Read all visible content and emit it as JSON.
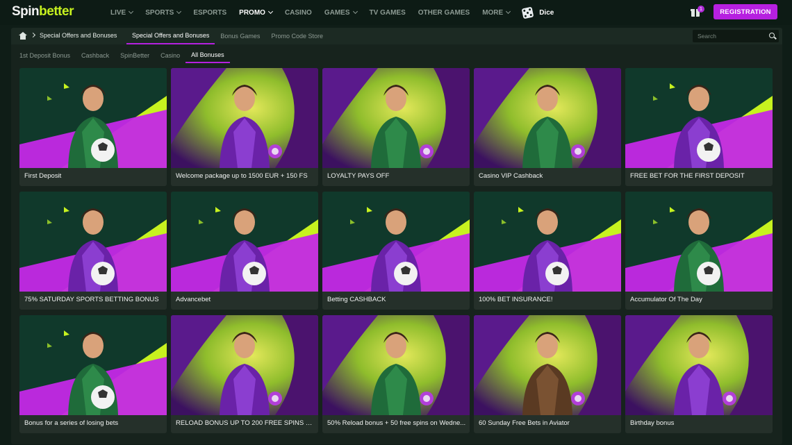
{
  "logo": {
    "part1": "Spin",
    "part2": "better"
  },
  "nav": [
    {
      "label": "LIVE",
      "caret": true,
      "active": false
    },
    {
      "label": "SPORTS",
      "caret": true,
      "active": false
    },
    {
      "label": "ESPORTS",
      "caret": false,
      "active": false
    },
    {
      "label": "PROMO",
      "caret": true,
      "active": true
    },
    {
      "label": "CASINO",
      "caret": false,
      "active": false
    },
    {
      "label": "GAMES",
      "caret": true,
      "active": false
    },
    {
      "label": "TV GAMES",
      "caret": false,
      "active": false
    },
    {
      "label": "OTHER GAMES",
      "caret": false,
      "active": false
    },
    {
      "label": "MORE",
      "caret": true,
      "active": false
    }
  ],
  "nav_dice": "Dice",
  "gift_count": "1",
  "registration_label": "REGISTRATION",
  "breadcrumb": {
    "current": "Special Offers and Bonuses"
  },
  "tabs": [
    {
      "label": "Special Offers and Bonuses",
      "active": true
    },
    {
      "label": "Bonus Games",
      "active": false
    },
    {
      "label": "Promo Code Store",
      "active": false
    }
  ],
  "search_placeholder": "Search",
  "filters": [
    {
      "label": "1st Deposit Bonus",
      "active": false
    },
    {
      "label": "Cashback",
      "active": false
    },
    {
      "label": "SpinBetter",
      "active": false
    },
    {
      "label": "Casino",
      "active": false
    },
    {
      "label": "All Bonuses",
      "active": true
    }
  ],
  "colors": {
    "accent": "#b620e0",
    "lime": "#c7f21f",
    "purple": "#9a28c9",
    "dark_green": "#123528"
  },
  "bonuses": [
    {
      "title": "First Deposit",
      "theme": "sport",
      "figure": "green"
    },
    {
      "title": "Welcome package up to 1500 EUR + 150 FS",
      "theme": "casino",
      "figure": "purple"
    },
    {
      "title": "LOYALTY PAYS OFF",
      "theme": "casino",
      "figure": "green"
    },
    {
      "title": "Casino VIP Cashback",
      "theme": "casino",
      "figure": "green"
    },
    {
      "title": "FREE BET FOR THE FIRST DEPOSIT",
      "theme": "sport",
      "figure": "purple"
    },
    {
      "title": "75% SATURDAY SPORTS BETTING BONUS",
      "theme": "sport",
      "figure": "purple"
    },
    {
      "title": "Advancebet",
      "theme": "sport",
      "figure": "purple"
    },
    {
      "title": "Betting CASHBACK",
      "theme": "sport",
      "figure": "purple"
    },
    {
      "title": "100% BET INSURANCE!",
      "theme": "sport",
      "figure": "purple"
    },
    {
      "title": "Accumulator Of The Day",
      "theme": "sport",
      "figure": "green"
    },
    {
      "title": "Bonus for a series of losing bets",
      "theme": "sport",
      "figure": "green"
    },
    {
      "title": "RELOAD BONUS UP TO 200 FREE SPINS ON ...",
      "theme": "casino",
      "figure": "purple"
    },
    {
      "title": "50% Reload bonus + 50 free spins on Wedne...",
      "theme": "casino",
      "figure": "green"
    },
    {
      "title": "60 Sunday Free Bets in Aviator",
      "theme": "casino",
      "figure": "brown"
    },
    {
      "title": "Birthday bonus",
      "theme": "casino",
      "figure": "purple"
    }
  ]
}
